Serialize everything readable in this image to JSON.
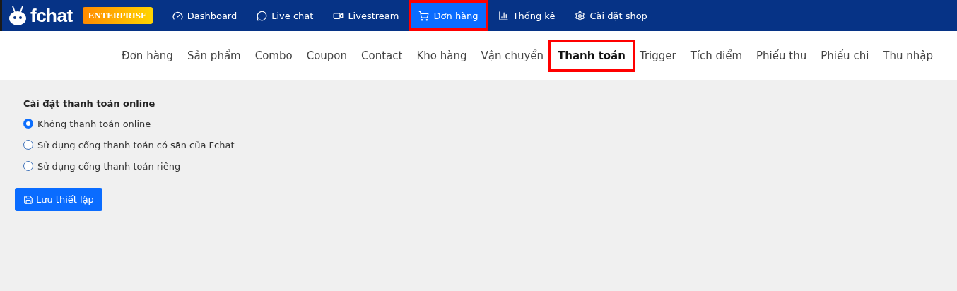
{
  "brand": {
    "name": "fchat",
    "badge": "ENTERPRISE"
  },
  "nav": [
    {
      "kind": "dashboard",
      "label": "Dashboard",
      "selected": false,
      "highlighted": false
    },
    {
      "kind": "chat",
      "label": "Live chat",
      "selected": false,
      "highlighted": false
    },
    {
      "kind": "video",
      "label": "Livestream",
      "selected": false,
      "highlighted": false
    },
    {
      "kind": "cart",
      "label": "Đơn hàng",
      "selected": true,
      "highlighted": true
    },
    {
      "kind": "chart",
      "label": "Thống kê",
      "selected": false,
      "highlighted": false
    },
    {
      "kind": "settings",
      "label": "Cài đặt shop",
      "selected": false,
      "highlighted": false
    }
  ],
  "tabs": [
    {
      "label": "Đơn hàng",
      "selected": false,
      "highlighted": false
    },
    {
      "label": "Sản phẩm",
      "selected": false,
      "highlighted": false
    },
    {
      "label": "Combo",
      "selected": false,
      "highlighted": false
    },
    {
      "label": "Coupon",
      "selected": false,
      "highlighted": false
    },
    {
      "label": "Contact",
      "selected": false,
      "highlighted": false
    },
    {
      "label": "Kho hàng",
      "selected": false,
      "highlighted": false
    },
    {
      "label": "Vận chuyển",
      "selected": false,
      "highlighted": false
    },
    {
      "label": "Thanh toán",
      "selected": true,
      "highlighted": true
    },
    {
      "label": "Trigger",
      "selected": false,
      "highlighted": false
    },
    {
      "label": "Tích điểm",
      "selected": false,
      "highlighted": false
    },
    {
      "label": "Phiếu thu",
      "selected": false,
      "highlighted": false
    },
    {
      "label": "Phiếu chi",
      "selected": false,
      "highlighted": false
    },
    {
      "label": "Thu nhập",
      "selected": false,
      "highlighted": false
    }
  ],
  "settings": {
    "title": "Cài đặt thanh toán online",
    "options": [
      {
        "label": "Không thanh toán online",
        "selected": true
      },
      {
        "label": "Sử dụng cổng thanh toán có sẵn của Fchat",
        "selected": false
      },
      {
        "label": "Sử dụng cổng thanh toán riêng",
        "selected": false
      }
    ],
    "save_button": "Lưu thiết lập"
  }
}
